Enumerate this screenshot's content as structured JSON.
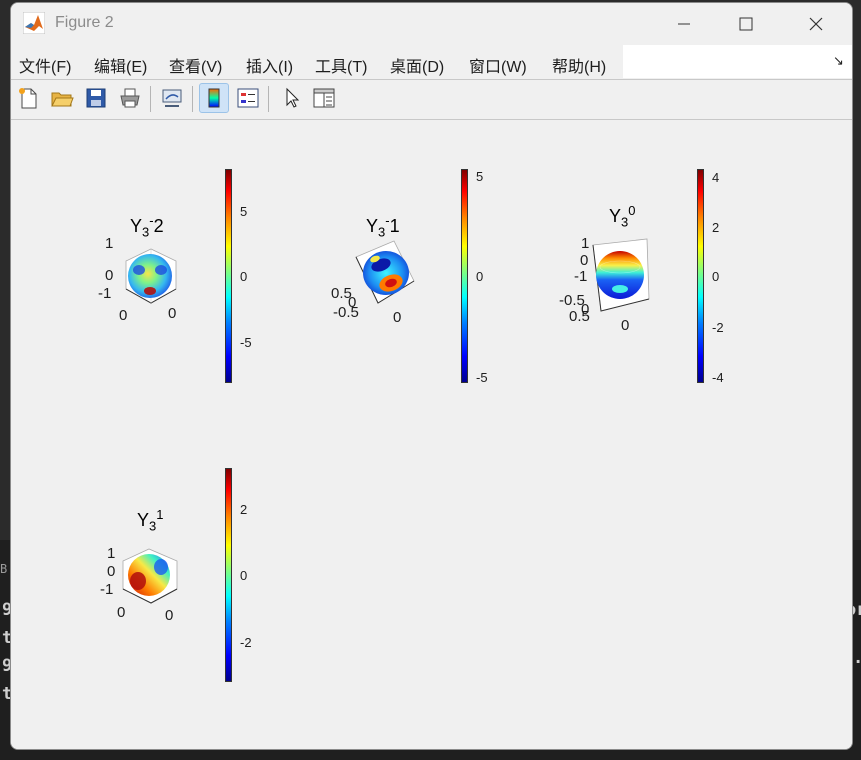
{
  "window": {
    "title": "Figure 2"
  },
  "menu": [
    "文件(F)",
    "编辑(E)",
    "查看(V)",
    "插入(I)",
    "工具(T)",
    "桌面(D)",
    "窗口(W)",
    "帮助(H)"
  ],
  "menu_overflow_glyph": "↘",
  "toolbar": [
    "new-figure-icon",
    "open-file-icon",
    "save-icon",
    "print-icon",
    "link-plot-icon",
    "colorbar-icon",
    "legend-icon",
    "pointer-icon",
    "property-inspector-icon"
  ],
  "background_text": {
    "tab_stub": "B",
    "lines": [
      "9",
      "t",
      "9",
      "t"
    ],
    "right_stub": "or",
    "right_dot": "."
  },
  "plots": [
    {
      "title_base": "Y",
      "title_sub": "3",
      "title_sup": "-",
      "title_suffix": "2",
      "axis_labels": [
        "1",
        "0",
        "-1",
        "0",
        "0"
      ],
      "colorbar_ticks": [
        "5",
        "0",
        "-5"
      ]
    },
    {
      "title_base": "Y",
      "title_sub": "3",
      "title_sup": "-",
      "title_suffix": "1",
      "axis_labels": [
        "0.5",
        "0",
        "-0.5",
        "0"
      ],
      "colorbar_ticks": [
        "5",
        "0",
        "-5"
      ]
    },
    {
      "title_base": "Y",
      "title_sub": "3",
      "title_sup": "0",
      "title_suffix": "",
      "axis_labels": [
        "1",
        "0",
        "-1",
        "-0.5",
        "0",
        "0.5",
        "0"
      ],
      "colorbar_ticks": [
        "4",
        "2",
        "0",
        "-2",
        "-4"
      ]
    },
    {
      "title_base": "Y",
      "title_sub": "3",
      "title_sup": "1",
      "title_suffix": "",
      "axis_labels": [
        "1",
        "0",
        "-1",
        "0",
        "0"
      ],
      "colorbar_ticks": [
        "2",
        "0",
        "-2"
      ]
    }
  ],
  "colors": {
    "window_bg": "#f0f0f0",
    "toolbar_active": "#cfe3f7",
    "terminal_bg": "#1f1f1f"
  }
}
